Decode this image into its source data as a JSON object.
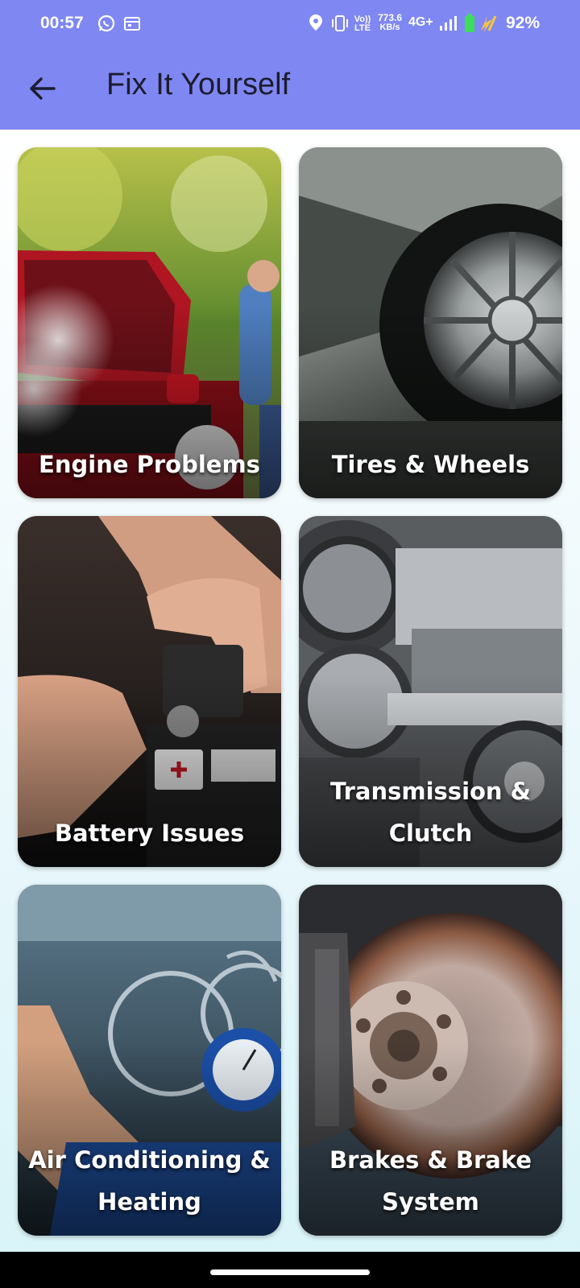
{
  "status_bar": {
    "time": "00:57",
    "speed_value": "773.6",
    "speed_unit": "KB/s",
    "volte_top": "Vo))",
    "volte_bottom": "LTE",
    "network": "4G+",
    "battery": "92%",
    "icons": [
      "whatsapp-icon",
      "calendar-icon",
      "location-icon",
      "vibrate-icon",
      "signal-icon",
      "battery-icon"
    ]
  },
  "app_bar": {
    "title": "Fix It Yourself",
    "back_icon": "arrow-left-icon",
    "color": "#7f87f2"
  },
  "categories": [
    {
      "label": "Engine Problems"
    },
    {
      "label": "Tires & Wheels"
    },
    {
      "label": "Battery Issues"
    },
    {
      "label": "Transmission & Clutch"
    },
    {
      "label": "Air Conditioning & Heating"
    },
    {
      "label": "Brakes & Brake System"
    }
  ]
}
